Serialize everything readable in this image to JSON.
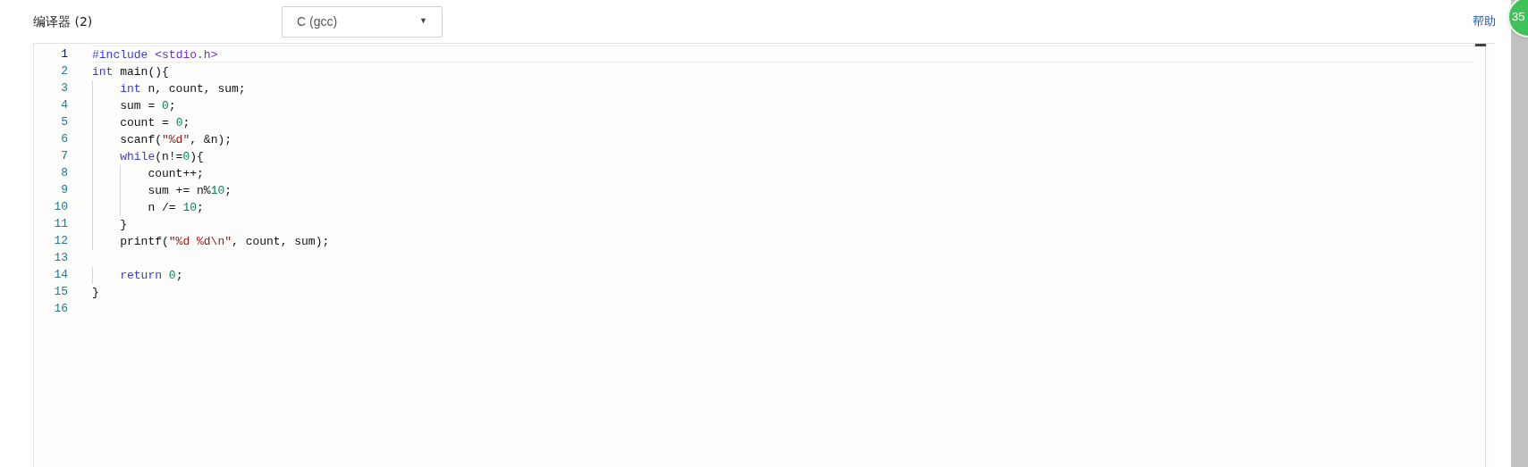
{
  "toolbar": {
    "compiler_label": "编译器 (2)",
    "language_select": {
      "value": "C (gcc)",
      "arrow": "▼"
    },
    "help_link": "帮助"
  },
  "badge": {
    "count": "35"
  },
  "editor": {
    "lines": [
      {
        "number": "1",
        "active": true,
        "tokens": [
          {
            "kind": "meta",
            "text": "#include"
          },
          {
            "kind": "header",
            "text": " <stdio.h>"
          }
        ]
      },
      {
        "number": "2",
        "active": false,
        "tokens": [
          {
            "kind": "keyword",
            "text": "int"
          },
          {
            "kind": "plain",
            "text": " main(){"
          }
        ]
      },
      {
        "number": "3",
        "active": false,
        "tokens": [
          {
            "kind": "keyword",
            "text": "    int"
          },
          {
            "kind": "plain",
            "text": " n, count, sum;"
          }
        ]
      },
      {
        "number": "4",
        "active": false,
        "tokens": [
          {
            "kind": "plain",
            "text": "    sum = "
          },
          {
            "kind": "number",
            "text": "0"
          },
          {
            "kind": "plain",
            "text": ";"
          }
        ]
      },
      {
        "number": "5",
        "active": false,
        "tokens": [
          {
            "kind": "plain",
            "text": "    count = "
          },
          {
            "kind": "number",
            "text": "0"
          },
          {
            "kind": "plain",
            "text": ";"
          }
        ]
      },
      {
        "number": "6",
        "active": false,
        "tokens": [
          {
            "kind": "plain",
            "text": "    scanf("
          },
          {
            "kind": "string",
            "text": "\"%d\""
          },
          {
            "kind": "plain",
            "text": ", &n);"
          }
        ]
      },
      {
        "number": "7",
        "active": false,
        "tokens": [
          {
            "kind": "keyword",
            "text": "    while"
          },
          {
            "kind": "plain",
            "text": "(n!="
          },
          {
            "kind": "number",
            "text": "0"
          },
          {
            "kind": "plain",
            "text": "){"
          }
        ]
      },
      {
        "number": "8",
        "active": false,
        "tokens": [
          {
            "kind": "plain",
            "text": "        count++;"
          }
        ]
      },
      {
        "number": "9",
        "active": false,
        "tokens": [
          {
            "kind": "plain",
            "text": "        sum += n%"
          },
          {
            "kind": "number",
            "text": "10"
          },
          {
            "kind": "plain",
            "text": ";"
          }
        ]
      },
      {
        "number": "10",
        "active": false,
        "tokens": [
          {
            "kind": "plain",
            "text": "        n /= "
          },
          {
            "kind": "number",
            "text": "10"
          },
          {
            "kind": "plain",
            "text": ";"
          }
        ]
      },
      {
        "number": "11",
        "active": false,
        "tokens": [
          {
            "kind": "plain",
            "text": "    }"
          }
        ]
      },
      {
        "number": "12",
        "active": false,
        "tokens": [
          {
            "kind": "plain",
            "text": "    printf("
          },
          {
            "kind": "string",
            "text": "\"%d %d\\n\""
          },
          {
            "kind": "plain",
            "text": ", count, sum);"
          }
        ]
      },
      {
        "number": "13",
        "active": false
      },
      {
        "number": "14",
        "active": false,
        "tokens": [
          {
            "kind": "keyword",
            "text": "    return"
          },
          {
            "kind": "number",
            "text": " 0"
          },
          {
            "kind": "plain",
            "text": ";"
          }
        ]
      },
      {
        "number": "15",
        "active": false,
        "tokens": [
          {
            "kind": "plain",
            "text": "}"
          }
        ]
      },
      {
        "number": "16",
        "active": false
      }
    ]
  }
}
